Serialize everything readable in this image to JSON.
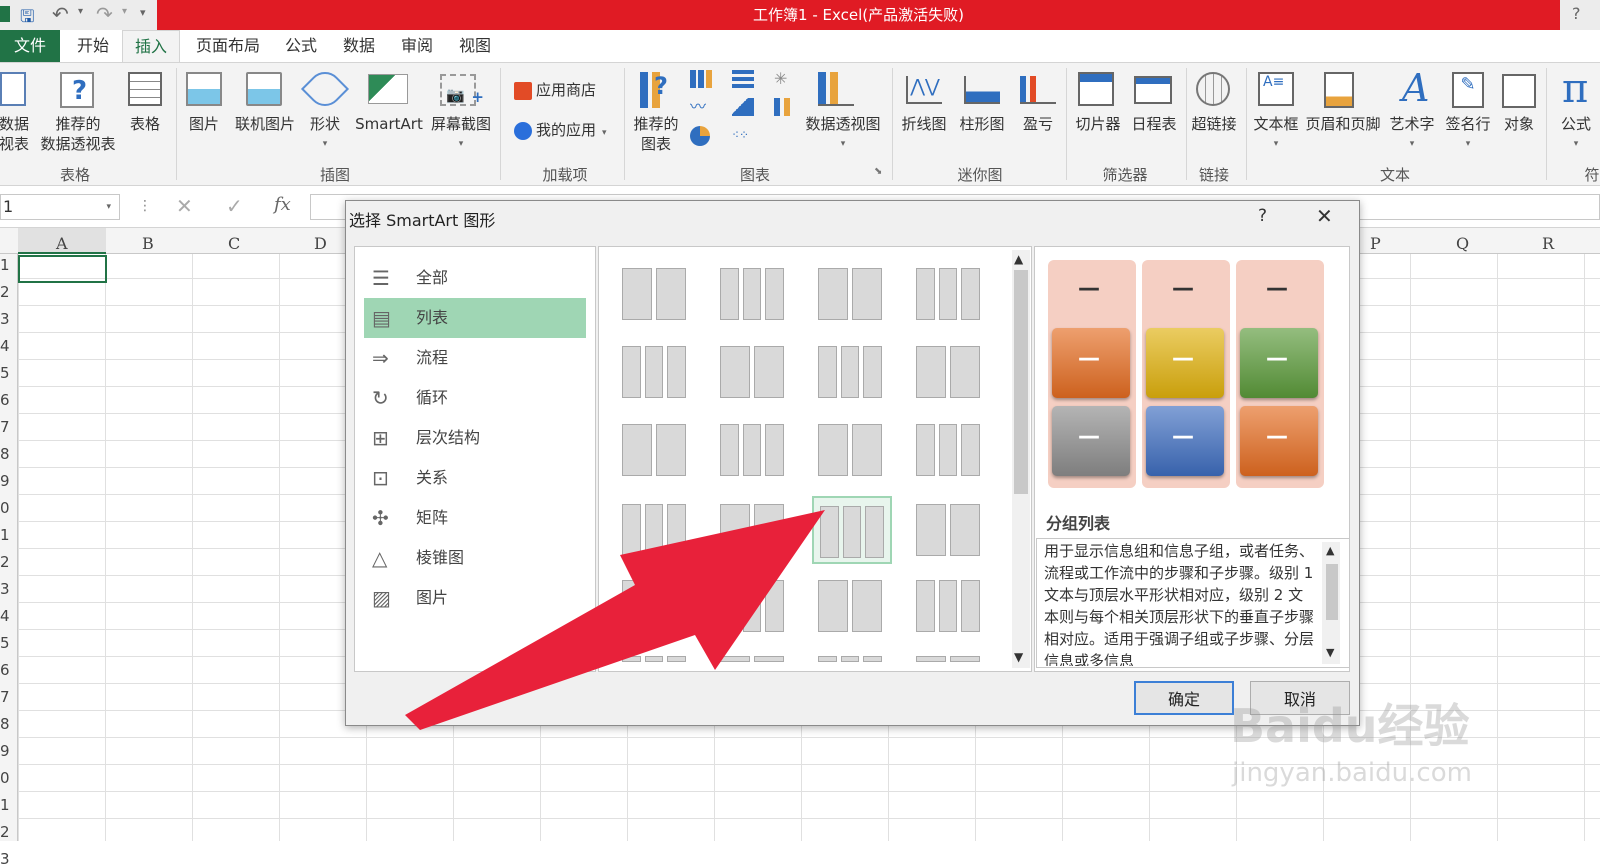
{
  "window": {
    "title": "工作簿1 -  Excel(产品激活失败)",
    "help": "?"
  },
  "tabs": [
    {
      "label": "文件",
      "active": false
    },
    {
      "label": "开始",
      "active": false
    },
    {
      "label": "插入",
      "active": true
    },
    {
      "label": "页面布局",
      "active": false
    },
    {
      "label": "公式",
      "active": false
    },
    {
      "label": "数据",
      "active": false
    },
    {
      "label": "审阅",
      "active": false
    },
    {
      "label": "视图",
      "active": false
    }
  ],
  "ribbon": {
    "tables": {
      "pivot_l1": "数据",
      "pivot_l2": "视表",
      "rec_pivot_l1": "推荐的",
      "rec_pivot_l2": "数据透视表",
      "table": "表格",
      "group": "表格"
    },
    "illustrations": {
      "pictures": "图片",
      "online_pictures": "联机图片",
      "shapes": "形状",
      "smartart": "SmartArt",
      "screenshot": "屏幕截图",
      "group": "插图"
    },
    "addins": {
      "store": "应用商店",
      "my_apps": "我的应用",
      "group": "加载项"
    },
    "charts": {
      "rec_charts_l1": "推荐的",
      "rec_charts_l2": "图表",
      "pivot_chart": "数据透视图",
      "group": "图表"
    },
    "sparklines": {
      "line": "折线图",
      "column": "柱形图",
      "winloss": "盈亏",
      "group": "迷你图"
    },
    "filters": {
      "slicer": "切片器",
      "timeline": "日程表",
      "group": "筛选器"
    },
    "links": {
      "hyperlink": "超链接",
      "group": "链接"
    },
    "text": {
      "textbox": "文本框",
      "header_footer": "页眉和页脚",
      "wordart": "艺术字",
      "signature": "签名行",
      "object": "对象",
      "group": "文本"
    },
    "symbols": {
      "equation": "公式",
      "partial": "符"
    }
  },
  "formula_bar": {
    "name_box": "1",
    "fx": "fx"
  },
  "grid": {
    "columns": [
      "A",
      "B",
      "C",
      "D",
      "P",
      "Q",
      "R"
    ],
    "rows": [
      "1",
      "2",
      "3",
      "4",
      "5",
      "6",
      "7",
      "8",
      "9",
      "0",
      "1",
      "2",
      "3",
      "4",
      "5",
      "6",
      "7",
      "8",
      "9",
      "0",
      "1",
      "2",
      "3"
    ]
  },
  "dialog": {
    "title": "选择 SmartArt 图形",
    "help": "?",
    "close": "✕",
    "categories": [
      {
        "label": "全部",
        "icon": "all-icon",
        "selected": false
      },
      {
        "label": "列表",
        "icon": "list-icon",
        "selected": true
      },
      {
        "label": "流程",
        "icon": "process-icon",
        "selected": false
      },
      {
        "label": "循环",
        "icon": "cycle-icon",
        "selected": false
      },
      {
        "label": "层次结构",
        "icon": "hierarchy-icon",
        "selected": false
      },
      {
        "label": "关系",
        "icon": "relationship-icon",
        "selected": false
      },
      {
        "label": "矩阵",
        "icon": "matrix-icon",
        "selected": false
      },
      {
        "label": "棱锥图",
        "icon": "pyramid-icon",
        "selected": false
      },
      {
        "label": "图片",
        "icon": "picture-icon",
        "selected": false
      }
    ],
    "selected_layout": "分组列表",
    "description": "用于显示信息组和信息子组，或者任务、流程或工作流中的步骤和子步骤。级别 1 文本与顶层水平形状相对应，级别 2 文本则与每个相关顶层形状下的垂直子步骤相对应。适用于强调子组或子步骤、分层信息或多信息",
    "preview_colors": {
      "col1_top": "#e46c21",
      "col1_bottom": "#8c8c8c",
      "col2_top": "#e0b10d",
      "col2_bottom": "#3e6dbf",
      "col3_top": "#5b9a3a",
      "col3_bottom": "#e46c21",
      "bg": "#f5cfc3"
    },
    "preview_dash": "—",
    "ok": "确定",
    "cancel": "取消"
  },
  "watermark": {
    "brand": "Baidu经验",
    "url": "jingyan.baidu.com"
  },
  "annotation": {
    "arrow_color": "#e8213a"
  }
}
